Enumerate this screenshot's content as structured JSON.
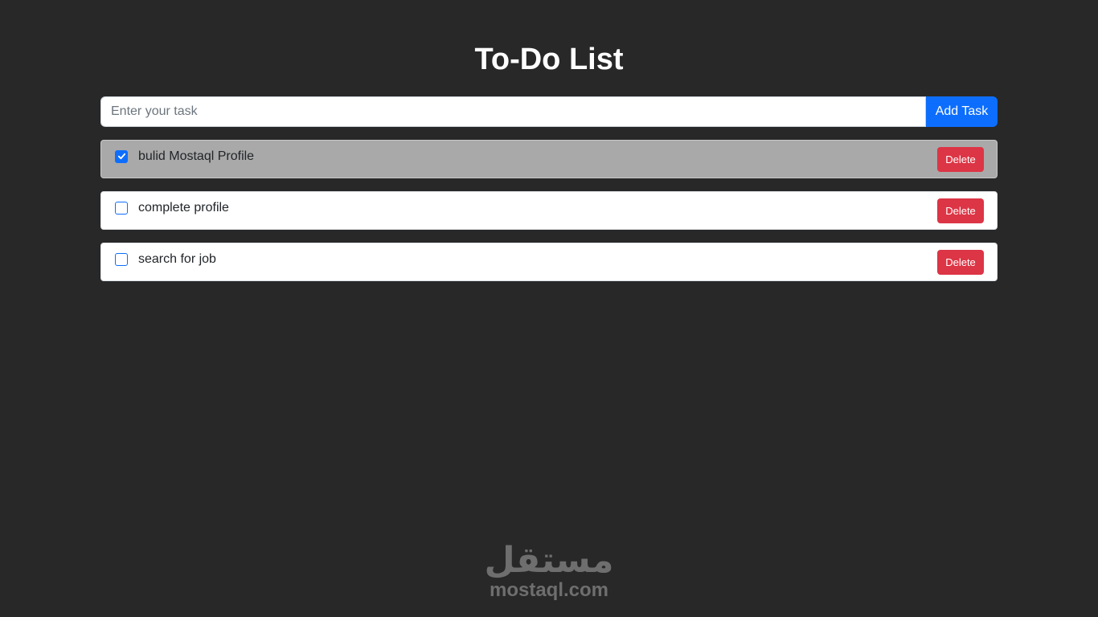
{
  "header": {
    "title": "To-Do List"
  },
  "form": {
    "input_value": "",
    "input_placeholder": "Enter your task",
    "add_label": "Add Task"
  },
  "tasks": [
    {
      "text": "bulid Mostaql Profile",
      "completed": true,
      "delete_label": "Delete"
    },
    {
      "text": "complete profile",
      "completed": false,
      "delete_label": "Delete"
    },
    {
      "text": "search for job",
      "completed": false,
      "delete_label": "Delete"
    }
  ],
  "watermark": {
    "arabic": "مستقل",
    "latin": "mostaql.com"
  },
  "colors": {
    "background": "#282828",
    "primary": "#0d6efd",
    "danger": "#dc3545",
    "completed_row": "#a9a9a9"
  },
  "icons": {
    "checkmark": "check-icon"
  }
}
